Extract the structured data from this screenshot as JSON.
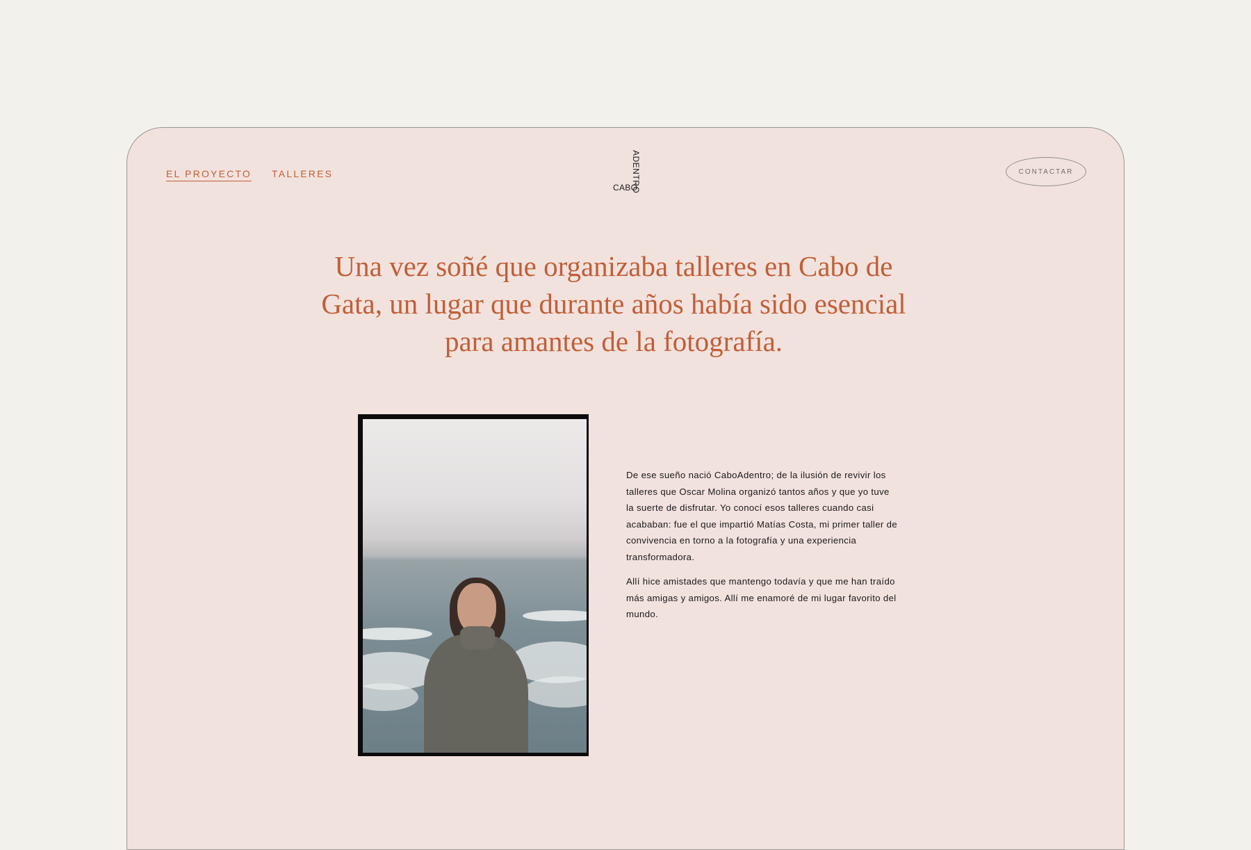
{
  "nav": {
    "items": [
      {
        "label": "EL PROYECTO",
        "active": true
      },
      {
        "label": "TALLERES",
        "active": false
      }
    ],
    "contact_label": "CONTACTAR"
  },
  "logo": {
    "vertical_text": "ADENTRO",
    "horizontal_text": "CABO"
  },
  "hero": {
    "headline": "Una vez soñé que organizaba talleres en Cabo de Gata, un lugar que durante años había sido esencial para amantes de la fotografía."
  },
  "content": {
    "paragraphs": [
      "De ese sueño nació CaboAdentro; de la ilusión de revivir los talleres que Oscar Molina organizó tantos años y que yo tuve la suerte de disfrutar. Yo conocí esos talleres cuando casi acababan: fue el que impartió Matías Costa, mi primer taller de convivencia en torno a la fotografía y una experiencia transformadora.",
      "Allí hice amistades que mantengo todavía y que me han traído más amigas y amigos. Allí me enamoré de mi lugar favorito del mundo."
    ]
  },
  "colors": {
    "page_background": "#f3f1ec",
    "card_background": "#f2e2de",
    "accent": "#c05f37",
    "text": "#1a1a1a"
  }
}
